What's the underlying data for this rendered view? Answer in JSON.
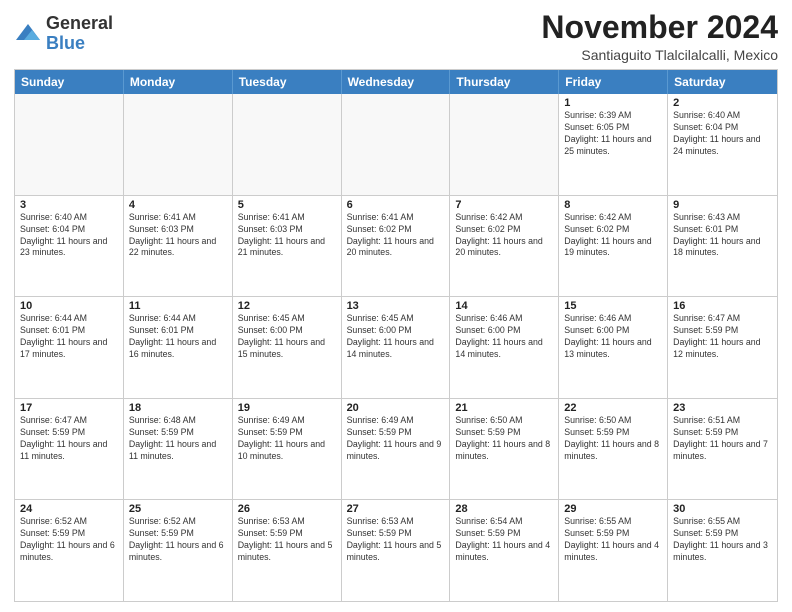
{
  "logo": {
    "general": "General",
    "blue": "Blue"
  },
  "title": {
    "month_year": "November 2024",
    "location": "Santiaguito Tlalcilalcalli, Mexico"
  },
  "header": {
    "days": [
      "Sunday",
      "Monday",
      "Tuesday",
      "Wednesday",
      "Thursday",
      "Friday",
      "Saturday"
    ]
  },
  "weeks": [
    [
      {
        "day": "",
        "empty": true
      },
      {
        "day": "",
        "empty": true
      },
      {
        "day": "",
        "empty": true
      },
      {
        "day": "",
        "empty": true
      },
      {
        "day": "",
        "empty": true
      },
      {
        "day": "1",
        "detail": "Sunrise: 6:39 AM\nSunset: 6:05 PM\nDaylight: 11 hours\nand 25 minutes."
      },
      {
        "day": "2",
        "detail": "Sunrise: 6:40 AM\nSunset: 6:04 PM\nDaylight: 11 hours\nand 24 minutes."
      }
    ],
    [
      {
        "day": "3",
        "detail": "Sunrise: 6:40 AM\nSunset: 6:04 PM\nDaylight: 11 hours\nand 23 minutes."
      },
      {
        "day": "4",
        "detail": "Sunrise: 6:41 AM\nSunset: 6:03 PM\nDaylight: 11 hours\nand 22 minutes."
      },
      {
        "day": "5",
        "detail": "Sunrise: 6:41 AM\nSunset: 6:03 PM\nDaylight: 11 hours\nand 21 minutes."
      },
      {
        "day": "6",
        "detail": "Sunrise: 6:41 AM\nSunset: 6:02 PM\nDaylight: 11 hours\nand 20 minutes."
      },
      {
        "day": "7",
        "detail": "Sunrise: 6:42 AM\nSunset: 6:02 PM\nDaylight: 11 hours\nand 20 minutes."
      },
      {
        "day": "8",
        "detail": "Sunrise: 6:42 AM\nSunset: 6:02 PM\nDaylight: 11 hours\nand 19 minutes."
      },
      {
        "day": "9",
        "detail": "Sunrise: 6:43 AM\nSunset: 6:01 PM\nDaylight: 11 hours\nand 18 minutes."
      }
    ],
    [
      {
        "day": "10",
        "detail": "Sunrise: 6:44 AM\nSunset: 6:01 PM\nDaylight: 11 hours\nand 17 minutes."
      },
      {
        "day": "11",
        "detail": "Sunrise: 6:44 AM\nSunset: 6:01 PM\nDaylight: 11 hours\nand 16 minutes."
      },
      {
        "day": "12",
        "detail": "Sunrise: 6:45 AM\nSunset: 6:00 PM\nDaylight: 11 hours\nand 15 minutes."
      },
      {
        "day": "13",
        "detail": "Sunrise: 6:45 AM\nSunset: 6:00 PM\nDaylight: 11 hours\nand 14 minutes."
      },
      {
        "day": "14",
        "detail": "Sunrise: 6:46 AM\nSunset: 6:00 PM\nDaylight: 11 hours\nand 14 minutes."
      },
      {
        "day": "15",
        "detail": "Sunrise: 6:46 AM\nSunset: 6:00 PM\nDaylight: 11 hours\nand 13 minutes."
      },
      {
        "day": "16",
        "detail": "Sunrise: 6:47 AM\nSunset: 5:59 PM\nDaylight: 11 hours\nand 12 minutes."
      }
    ],
    [
      {
        "day": "17",
        "detail": "Sunrise: 6:47 AM\nSunset: 5:59 PM\nDaylight: 11 hours\nand 11 minutes."
      },
      {
        "day": "18",
        "detail": "Sunrise: 6:48 AM\nSunset: 5:59 PM\nDaylight: 11 hours\nand 11 minutes."
      },
      {
        "day": "19",
        "detail": "Sunrise: 6:49 AM\nSunset: 5:59 PM\nDaylight: 11 hours\nand 10 minutes."
      },
      {
        "day": "20",
        "detail": "Sunrise: 6:49 AM\nSunset: 5:59 PM\nDaylight: 11 hours\nand 9 minutes."
      },
      {
        "day": "21",
        "detail": "Sunrise: 6:50 AM\nSunset: 5:59 PM\nDaylight: 11 hours\nand 8 minutes."
      },
      {
        "day": "22",
        "detail": "Sunrise: 6:50 AM\nSunset: 5:59 PM\nDaylight: 11 hours\nand 8 minutes."
      },
      {
        "day": "23",
        "detail": "Sunrise: 6:51 AM\nSunset: 5:59 PM\nDaylight: 11 hours\nand 7 minutes."
      }
    ],
    [
      {
        "day": "24",
        "detail": "Sunrise: 6:52 AM\nSunset: 5:59 PM\nDaylight: 11 hours\nand 6 minutes."
      },
      {
        "day": "25",
        "detail": "Sunrise: 6:52 AM\nSunset: 5:59 PM\nDaylight: 11 hours\nand 6 minutes."
      },
      {
        "day": "26",
        "detail": "Sunrise: 6:53 AM\nSunset: 5:59 PM\nDaylight: 11 hours\nand 5 minutes."
      },
      {
        "day": "27",
        "detail": "Sunrise: 6:53 AM\nSunset: 5:59 PM\nDaylight: 11 hours\nand 5 minutes."
      },
      {
        "day": "28",
        "detail": "Sunrise: 6:54 AM\nSunset: 5:59 PM\nDaylight: 11 hours\nand 4 minutes."
      },
      {
        "day": "29",
        "detail": "Sunrise: 6:55 AM\nSunset: 5:59 PM\nDaylight: 11 hours\nand 4 minutes."
      },
      {
        "day": "30",
        "detail": "Sunrise: 6:55 AM\nSunset: 5:59 PM\nDaylight: 11 hours\nand 3 minutes."
      }
    ]
  ]
}
